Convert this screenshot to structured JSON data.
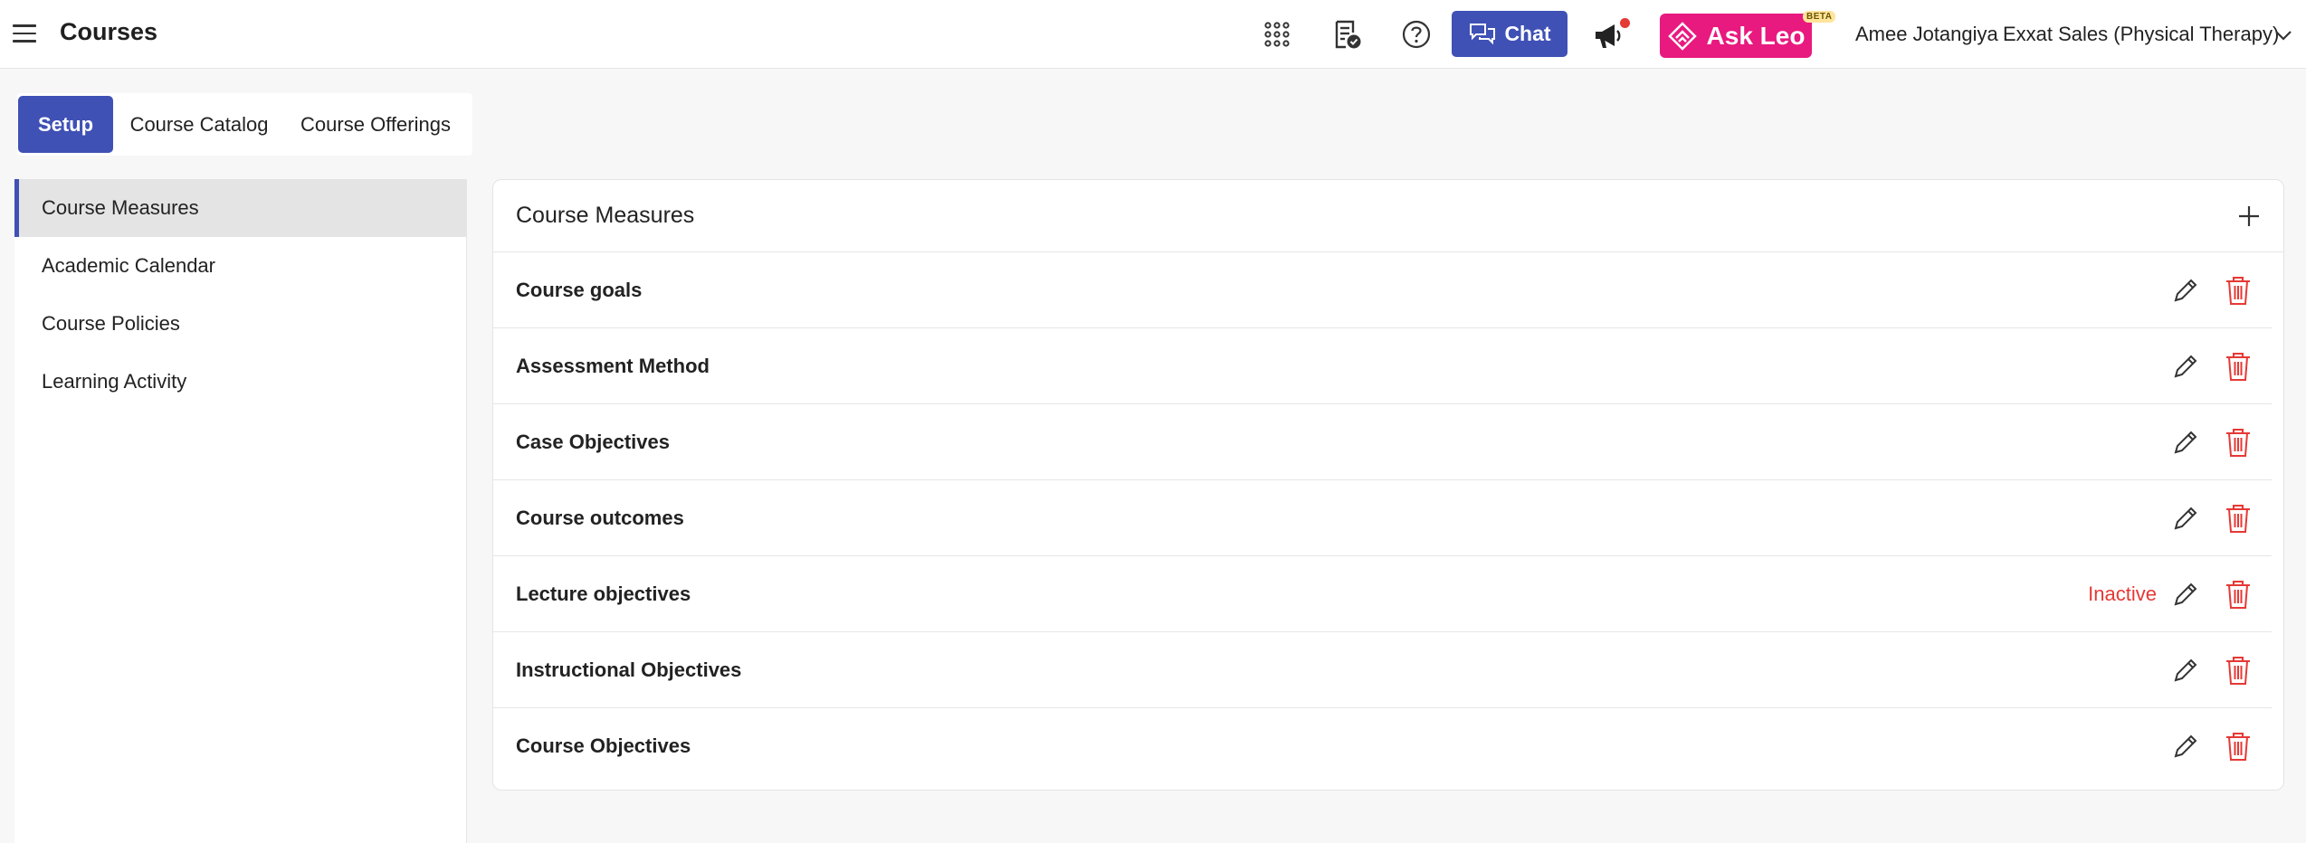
{
  "header": {
    "title": "Courses",
    "icons": [
      "menu-icon",
      "apps-grid-icon",
      "checklist-icon",
      "help-icon",
      "megaphone-icon"
    ],
    "chat_label": "Chat",
    "leo_label": "Ask Leo",
    "beta_label": "BETA",
    "user_name": "Amee Jotangiya",
    "org_name": "Exxat Sales (Physical Therapy)",
    "accent_color": "#3f51b5",
    "leo_color": "#e8197f"
  },
  "tabs": [
    {
      "label": "Setup",
      "active": true
    },
    {
      "label": "Course Catalog",
      "active": false
    },
    {
      "label": "Course Offerings",
      "active": false
    }
  ],
  "sidebar": {
    "items": [
      {
        "label": "Course Measures",
        "active": true
      },
      {
        "label": "Academic Calendar",
        "active": false
      },
      {
        "label": "Course Policies",
        "active": false
      },
      {
        "label": "Learning Activity",
        "active": false
      }
    ]
  },
  "main": {
    "title": "Course Measures",
    "rows": [
      {
        "label": "Course goals",
        "status": ""
      },
      {
        "label": "Assessment Method",
        "status": ""
      },
      {
        "label": "Case Objectives",
        "status": ""
      },
      {
        "label": "Course outcomes",
        "status": ""
      },
      {
        "label": "Lecture objectives",
        "status": "Inactive"
      },
      {
        "label": "Instructional Objectives",
        "status": ""
      },
      {
        "label": "Course Objectives",
        "status": ""
      }
    ],
    "status_color": "#e53935",
    "delete_color": "#e53935"
  }
}
